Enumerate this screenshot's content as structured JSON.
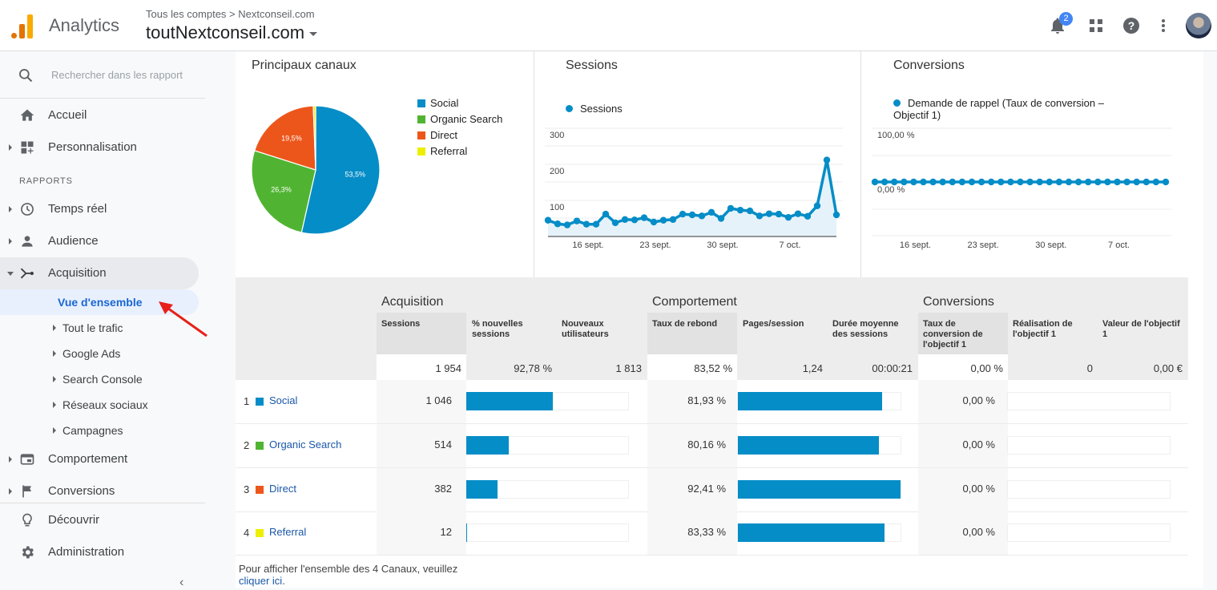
{
  "header": {
    "app_name": "Analytics",
    "breadcrumb": "Tous les comptes > Nextconseil.com",
    "account": "toutNextconseil.com",
    "notifications_count": "2",
    "icons": [
      "bell-icon",
      "apps-grid-icon",
      "help-icon",
      "more-vert-icon",
      "avatar"
    ]
  },
  "sidebar": {
    "search_placeholder": "Rechercher dans les rapport",
    "items": [
      {
        "label": "Accueil",
        "icon": "home-icon"
      },
      {
        "label": "Personnalisation",
        "icon": "dashboard-add-icon"
      },
      {
        "label": "Temps réel",
        "icon": "clock-icon"
      },
      {
        "label": "Audience",
        "icon": "person-icon"
      },
      {
        "label": "Acquisition",
        "icon": "acquisition-icon"
      },
      {
        "label": "Comportement",
        "icon": "behavior-icon"
      },
      {
        "label": "Conversions",
        "icon": "flag-icon"
      },
      {
        "label": "Découvrir",
        "icon": "lightbulb-icon"
      },
      {
        "label": "Administration",
        "icon": "gear-icon"
      }
    ],
    "section_label": "RAPPORTS",
    "acquisition_sub": [
      {
        "label": "Vue d'ensemble",
        "active": true
      },
      {
        "label": "Tout le trafic"
      },
      {
        "label": "Google Ads"
      },
      {
        "label": "Search Console"
      },
      {
        "label": "Réseaux sociaux"
      },
      {
        "label": "Campagnes"
      }
    ],
    "collapse_glyph": "‹"
  },
  "cards": {
    "channels_title": "Principaux canaux",
    "sessions_title": "Sessions",
    "sessions_legend": "Sessions",
    "conversions_title": "Conversions",
    "conversions_legend_line1": "Demande de rappel (Taux de conversion –",
    "conversions_legend_line2": "Objectif 1)"
  },
  "chart_data": [
    {
      "type": "pie",
      "title": "Principaux canaux",
      "legend": "right",
      "categories": [
        "Social",
        "Organic Search",
        "Direct",
        "Referral"
      ],
      "values": [
        53.5,
        26.3,
        19.5,
        0.6
      ],
      "labels": [
        "53,5%",
        "26,3%",
        "19,5%",
        ""
      ],
      "colors": [
        "#058dc7",
        "#50b432",
        "#ed561b",
        "#edef00"
      ]
    },
    {
      "type": "area",
      "title": "Sessions",
      "series": [
        {
          "name": "Sessions",
          "values": [
            45,
            35,
            32,
            43,
            34,
            34,
            62,
            38,
            47,
            46,
            52,
            40,
            45,
            47,
            62,
            60,
            57,
            67,
            50,
            78,
            73,
            71,
            57,
            63,
            62,
            53,
            63,
            56,
            85,
            212,
            60
          ]
        }
      ],
      "x_ticks": [
        "16 sept.",
        "23 sept.",
        "30 sept.",
        "7 oct."
      ],
      "x_tick_index": [
        4,
        11,
        18,
        25
      ],
      "y_ticks": [
        "100",
        "200",
        "300"
      ],
      "ylim": [
        0,
        300
      ],
      "color": "#058dc7"
    },
    {
      "type": "line",
      "title": "Conversions",
      "series": [
        {
          "name": "Demande de rappel (Taux de conversion – Objectif 1)",
          "values": [
            0,
            0,
            0,
            0,
            0,
            0,
            0,
            0,
            0,
            0,
            0,
            0,
            0,
            0,
            0,
            0,
            0,
            0,
            0,
            0,
            0,
            0,
            0,
            0,
            0,
            0,
            0,
            0,
            0,
            0,
            0
          ]
        }
      ],
      "x_ticks": [
        "16 sept.",
        "23 sept.",
        "30 sept.",
        "7 oct."
      ],
      "x_tick_index": [
        4,
        11,
        18,
        25
      ],
      "y_ticks": [
        "100,00 %",
        "0,00 %"
      ],
      "ylim": [
        -100,
        100
      ],
      "color": "#058dc7"
    }
  ],
  "table": {
    "groups": [
      "Acquisition",
      "Comportement",
      "Conversions"
    ],
    "columns": [
      "Sessions",
      "% nouvelles sessions",
      "Nouveaux utilisateurs",
      "Taux de rebond",
      "Pages/session",
      "Durée moyenne des sessions",
      "Taux de conversion de l'objectif 1",
      "Réalisation de l'objectif 1",
      "Valeur de l'objectif 1"
    ],
    "totals": [
      "1 954",
      "92,78 %",
      "1 813",
      "83,52 %",
      "1,24",
      "00:00:21",
      "0,00 %",
      "0",
      "0,00 €"
    ],
    "rows": [
      {
        "rank": "1",
        "name": "Social",
        "color": "#058dc7",
        "sessions": "1 046",
        "sessions_share": 0.535,
        "bounce": "81,93 %",
        "bounce_share": 0.8866,
        "conv": "0,00 %",
        "conv_share": 0
      },
      {
        "rank": "2",
        "name": "Organic Search",
        "color": "#50b432",
        "sessions": "514",
        "sessions_share": 0.263,
        "bounce": "80,16 %",
        "bounce_share": 0.8674,
        "conv": "0,00 %",
        "conv_share": 0
      },
      {
        "rank": "3",
        "name": "Direct",
        "color": "#ed561b",
        "sessions": "382",
        "sessions_share": 0.195,
        "bounce": "92,41 %",
        "bounce_share": 1.0,
        "conv": "0,00 %",
        "conv_share": 0
      },
      {
        "rank": "4",
        "name": "Referral",
        "color": "#edef00",
        "sessions": "12",
        "sessions_share": 0.006,
        "bounce": "83,33 %",
        "bounce_share": 0.9017,
        "conv": "0,00 %",
        "conv_share": 0
      }
    ],
    "footer_text": "Pour afficher l'ensemble des 4 Canaux, veuillez",
    "footer_link": "cliquer ici",
    "footer_end": "."
  }
}
